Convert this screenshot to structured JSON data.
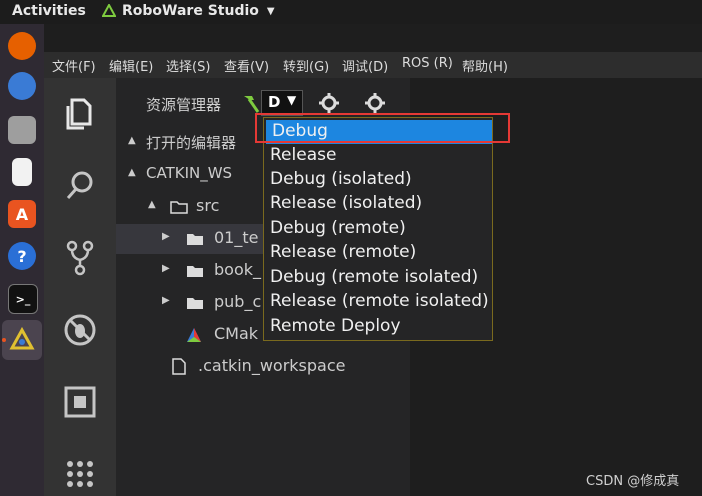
{
  "topbar": {
    "activities": "Activities",
    "app_name": "RoboWare Studio"
  },
  "menubar": [
    "文件(F)",
    "编辑(E)",
    "选择(S)",
    "查看(V)",
    "转到(G)",
    "调试(D)",
    "ROS (R)",
    "帮助(H)"
  ],
  "sidebar": {
    "title": "资源管理器",
    "config_value": "D",
    "sections": {
      "open_editors": "打开的编辑器",
      "workspace": "CATKIN_WS"
    },
    "tree": {
      "src": "src",
      "item1": "01_te",
      "item2": "book_",
      "item3": "pub_c",
      "item4": "CMak",
      "catkin_workspace": ".catkin_workspace"
    }
  },
  "dropdown": {
    "options": [
      "Debug",
      "Release",
      "Debug (isolated)",
      "Release (isolated)",
      "Debug (remote)",
      "Release (remote)",
      "Debug (remote isolated)",
      "Release (remote isolated)",
      "Remote Deploy"
    ],
    "selected_index": 0
  },
  "watermark": "CSDN @修成真",
  "colors": {
    "selection": "#1d86e0",
    "highlight_box": "#e53935",
    "dock_bg": "#2f2a33"
  }
}
